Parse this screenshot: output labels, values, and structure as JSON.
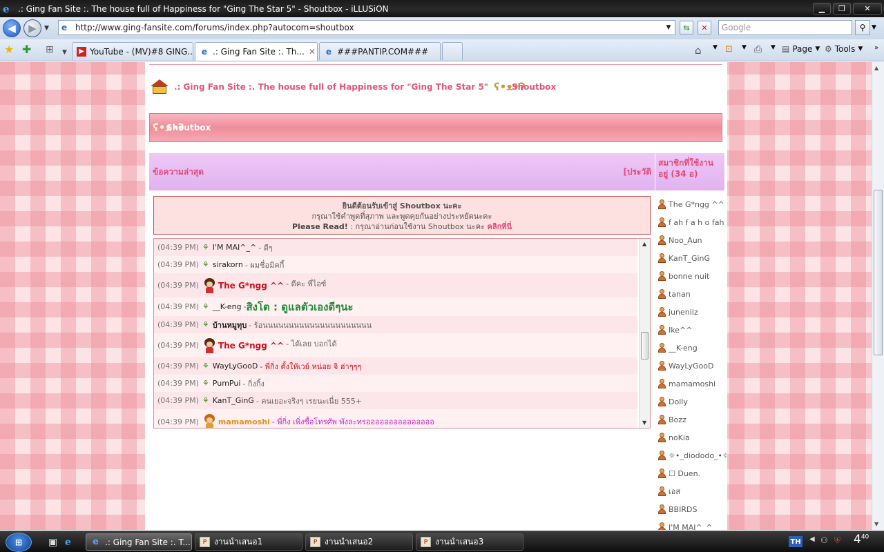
{
  "window": {
    "title": ".: Ging Fan Site :. The house full of Happiness for \"Ging The Star 5\" - Shoutbox - iLLUSiON"
  },
  "navbar": {
    "url": "http://www.ging-fansite.com/forums/index.php?autocom=shoutbox",
    "search_placeholder": "Google"
  },
  "tabs": [
    {
      "label": "YouTube - (MV)#8 GING...",
      "icon": "youtube-icon"
    },
    {
      "label": ".: Ging Fan Site :. Th...",
      "icon": "ie-page-icon",
      "active": true
    },
    {
      "label": "###PANTIP.COM###",
      "icon": "ie-page-icon"
    }
  ],
  "command_bar": {
    "page_label": "Page",
    "tools_label": "Tools"
  },
  "page": {
    "breadcrumb_site": ".: Ging Fan Site :. The house full of Happiness for \"Ging The Star 5\"",
    "breadcrumb_current": "Shoutbox",
    "header_title": "Shoutbox",
    "latest_label": "ข้อความล่าสุด",
    "history_label": "[ประวัติ",
    "members_label": "สมาชิกที่ใช้งานอยู่ (34 อ)",
    "welcome": {
      "line1": "ยินดีต้อนรับเข้าสู่ Shoutbox นะคะ",
      "line2": "กรุณาใช้คำพูดที่สุภาพ และพูดคุยกันอย่างประหยัดนะคะ",
      "line3_bold": "Please Read!",
      "line3_text": " : กรุณาอ่านก่อนใช้งาน Shoutbox นะคะ ",
      "line3_link": "คลิกที่นี่"
    }
  },
  "shouts": [
    {
      "time": "(04:39 PM)",
      "user": "I'M MAI^_^",
      "message": " - ดีๆ",
      "style": "normal"
    },
    {
      "time": "(04:39 PM)",
      "user": "sirakorn",
      "message": " - ผมชื่อมิคกี้",
      "style": "normal"
    },
    {
      "time": "(04:39 PM)",
      "user": "The G*ngg ^^",
      "message": " - ดีคะ พี่ไอซ์",
      "style": "admin"
    },
    {
      "time": "(04:39 PM)",
      "user": "__K-eng",
      "message": " - ",
      "message_big": "สิงโต : ดูแลตัวเองดีๆนะ",
      "style": "big"
    },
    {
      "time": "(04:39 PM)",
      "user": "บ้านหมูทุบ",
      "message": " - ร้อนนนนนนนนนนนนนนนนนนนนน",
      "style": "boldname"
    },
    {
      "time": "(04:39 PM)",
      "user": "The G*ngg ^^",
      "message": " - ได้เลย บอกได้",
      "style": "admin"
    },
    {
      "time": "(04:39 PM)",
      "user": "WayLyGooD",
      "message": " - พี่กิ่ง ตั้งให้เวย์ หน่อย จิ ฮ่าๆๆๆ",
      "style": "redmsg"
    },
    {
      "time": "(04:39 PM)",
      "user": "PumPui",
      "message": " - กิ่งกิ้ง",
      "style": "normal"
    },
    {
      "time": "(04:39 PM)",
      "user": "KanT_GinG",
      "message": " - คนเยอะจริงๆ เรยนะเนี่ย 555+",
      "style": "normal"
    },
    {
      "time": "(04:39 PM)",
      "user": "mamamoshi",
      "message": " - พี่กิ่ง เพิ่งซื้อโทรศัพ พังละทรอออออออออออออออ",
      "style": "mod"
    }
  ],
  "members": [
    "The G*ngg ^^",
    "f ah f a h o fah",
    "Noo_Aun",
    "KanT_GinG",
    "bonne nuit",
    "tanan",
    "juneniiz",
    "Ike^^",
    "__K-eng",
    "WayLyGooD",
    "mamamoshi",
    "Dolly",
    "Bozz",
    "noKia",
    "☼•_diododo_•☼",
    "☐ Duen.",
    "เอส",
    "BBIRDS",
    "I'M MAI^_^"
  ],
  "taskbar": {
    "items": [
      {
        "label": ".: Ging Fan Site :. T...",
        "active": true
      },
      {
        "label": "งานนำเสนอ1"
      },
      {
        "label": "งานนำเสนอ2"
      },
      {
        "label": "งานนำเสนอ3"
      }
    ],
    "lang": "TH",
    "clock_hour": "4",
    "clock_min": "40"
  },
  "colors": {
    "accent_pink": "#e04a7a",
    "admin_red": "#d0101a",
    "mod_orange": "#e0901a",
    "sprout_green": "#3a8c1e"
  }
}
